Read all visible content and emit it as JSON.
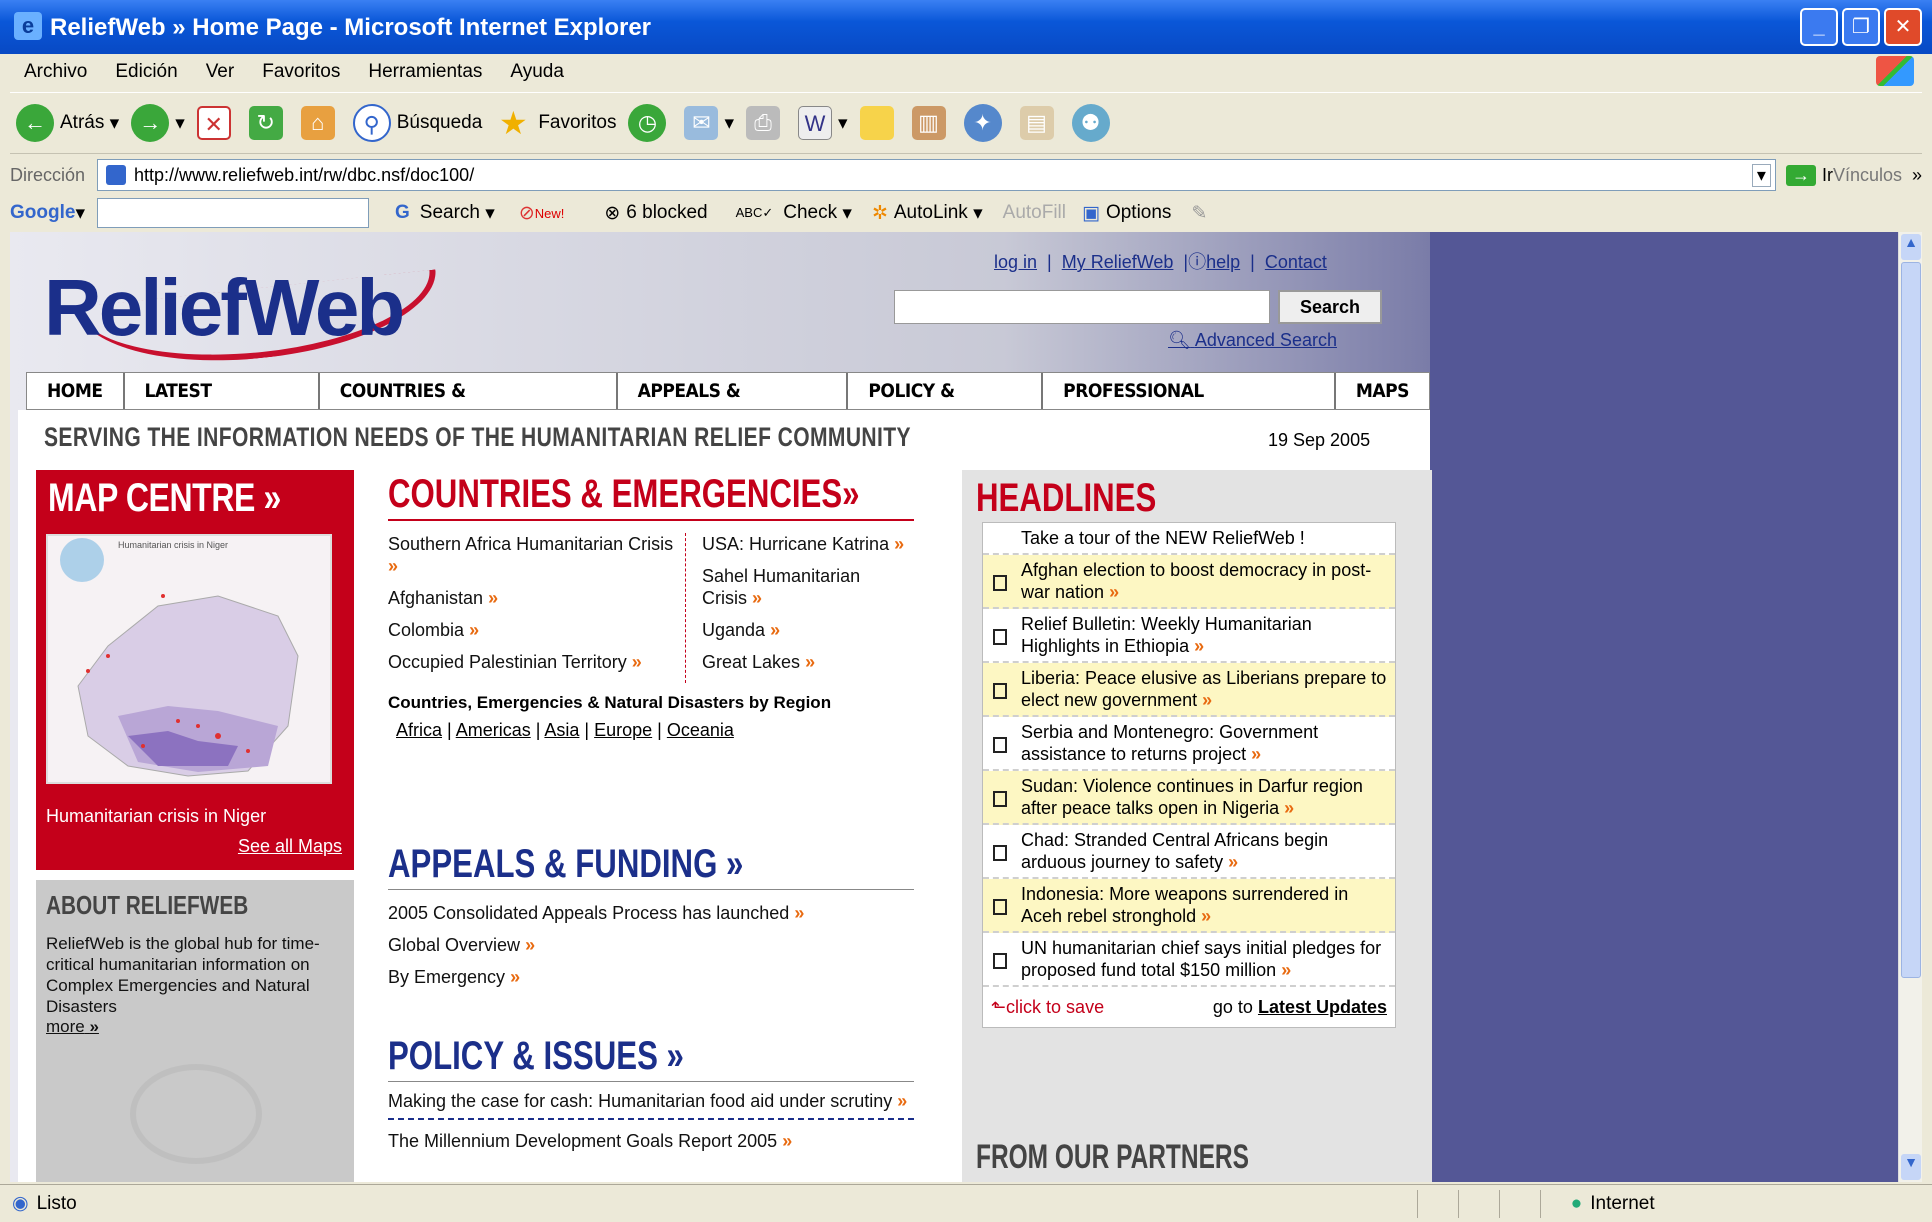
{
  "window": {
    "title": "ReliefWeb » Home Page - Microsoft Internet Explorer"
  },
  "menu": [
    "Archivo",
    "Edición",
    "Ver",
    "Favoritos",
    "Herramientas",
    "Ayuda"
  ],
  "toolbar": {
    "back": "Atrás",
    "search": "Búsqueda",
    "favorites": "Favoritos"
  },
  "address": {
    "label": "Dirección",
    "url": "http://www.reliefweb.int/rw/dbc.nsf/doc100/",
    "go": "Ir",
    "links": "Vínculos"
  },
  "google": {
    "logo": "Google",
    "search": "Search",
    "new": "New!",
    "blocked": "6 blocked",
    "check": "Check",
    "autolink": "AutoLink",
    "autofill": "AutoFill",
    "options": "Options"
  },
  "site": {
    "logo": "ReliefWeb",
    "toplinks": {
      "login": "log in",
      "my": "My ReliefWeb",
      "help": "help",
      "contact": "Contact"
    },
    "search_btn": "Search",
    "advanced": "Advanced Search",
    "nav": [
      "HOME",
      "LATEST UPDATES",
      "COUNTRIES & EMERGENCIES",
      "APPEALS & FUNDING",
      "POLICY & ISSUES",
      "PROFESSIONAL RESOURCES",
      "MAPS"
    ],
    "tagline": "SERVING THE INFORMATION NEEDS OF THE HUMANITARIAN RELIEF COMMUNITY",
    "date": "19 Sep 2005",
    "map": {
      "title": "MAP CENTRE »",
      "map_title": "Humanitarian crisis in Niger",
      "caption": "Humanitarian crisis in Niger",
      "see_all": "See all Maps"
    },
    "about": {
      "title": "ABOUT RELIEFWEB",
      "text": "ReliefWeb is the global hub for time-critical humanitarian information on Complex Emergencies and Natural Disasters",
      "more": "more"
    },
    "countries": {
      "title": "COUNTRIES & EMERGENCIES»",
      "left": [
        "Southern Africa Humanitarian Crisis",
        "Afghanistan",
        "Colombia",
        "Occupied Palestinian Territory"
      ],
      "right": [
        "USA: Hurricane Katrina",
        "Sahel Humanitarian Crisis",
        "Uganda",
        "Great Lakes"
      ],
      "by_region": "Countries, Emergencies & Natural Disasters by Region",
      "regions": [
        "Africa",
        "Americas",
        "Asia",
        "Europe",
        "Oceania"
      ]
    },
    "appeals": {
      "title": "APPEALS & FUNDING »",
      "items": [
        "2005 Consolidated Appeals Process has launched",
        "Global Overview",
        "By Emergency"
      ]
    },
    "policy": {
      "title": "POLICY & ISSUES »",
      "items": [
        "Making the case for cash: Humanitarian food aid under scrutiny",
        "The Millennium Development Goals Report 2005"
      ]
    },
    "headlines": {
      "title": "HEADLINES",
      "items": [
        "Take a tour of the NEW ReliefWeb !",
        "Afghan election to boost democracy in post-war nation",
        "Relief Bulletin: Weekly Humanitarian Highlights in Ethiopia",
        "Liberia: Peace elusive as Liberians prepare to elect new government",
        "Serbia and Montenegro: Government assistance to returns project",
        "Sudan: Violence continues in Darfur region after peace talks open in Nigeria",
        "Chad: Stranded Central Africans begin arduous journey to safety",
        "Indonesia: More weapons surrendered in Aceh rebel stronghold",
        "UN humanitarian chief says initial pledges for proposed fund total $150 million"
      ],
      "save": "click to save",
      "goto": "go to",
      "latest": "Latest Updates"
    },
    "partners": "FROM OUR PARTNERS"
  },
  "status": {
    "text": "Listo",
    "zone": "Internet"
  }
}
